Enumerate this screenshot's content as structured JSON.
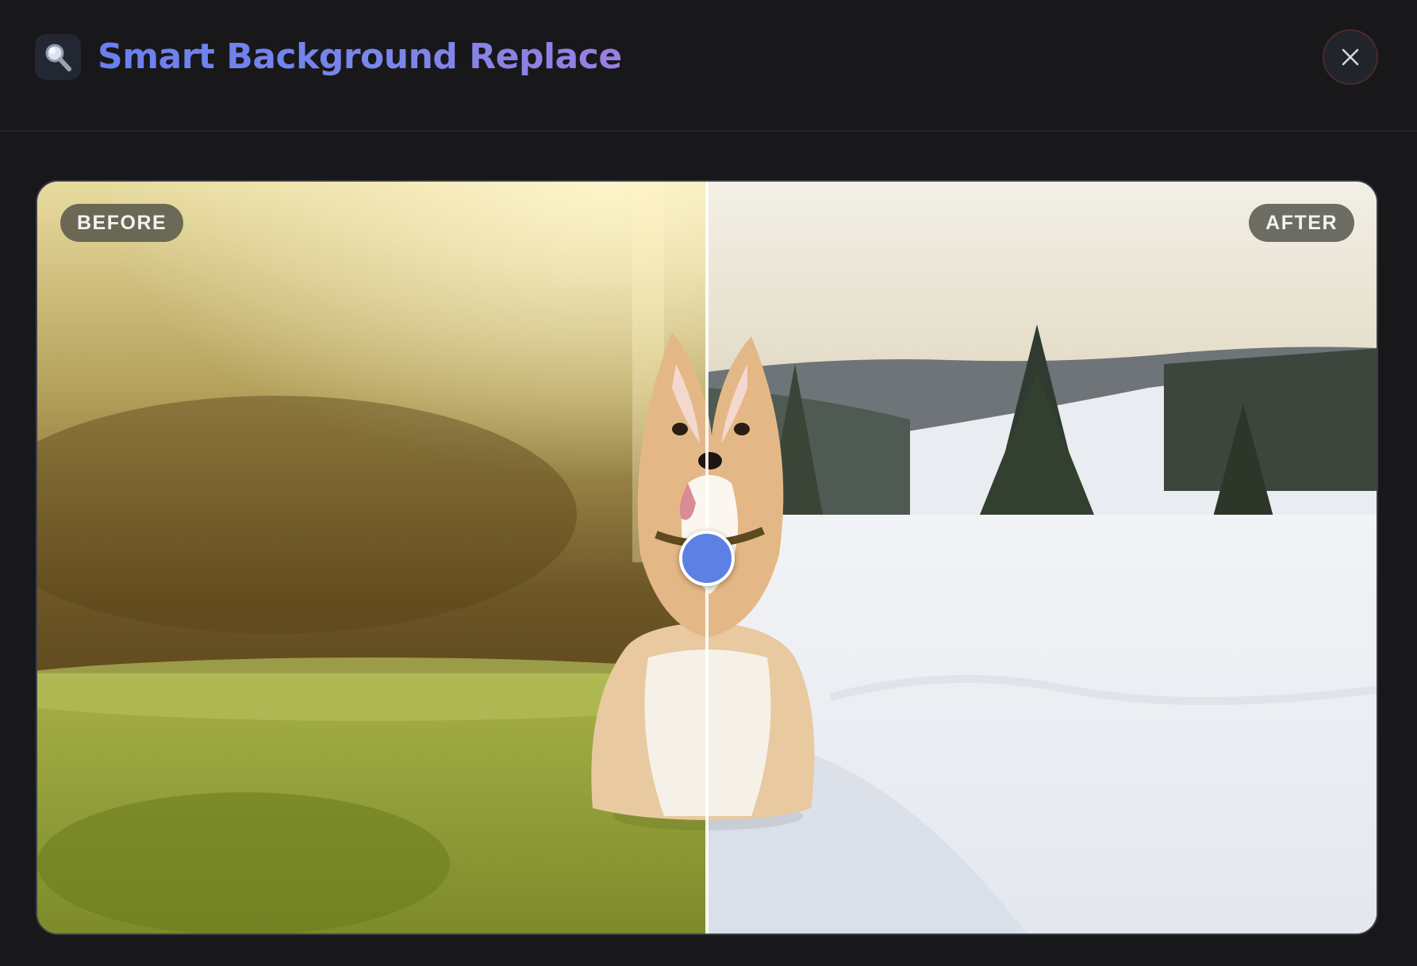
{
  "header": {
    "title": "Smart Background Replace",
    "icon": "magnifier-icon",
    "close_icon": "close-icon"
  },
  "comparison": {
    "before_label": "BEFORE",
    "after_label": "AFTER",
    "slider_position": 0.5,
    "handle_color": "#5d80e4"
  },
  "colors": {
    "background": "#18181b",
    "title_gradient_start": "#6a7ff0",
    "title_gradient_end": "#9a7fe0",
    "close_border": "#4a2a2e"
  }
}
